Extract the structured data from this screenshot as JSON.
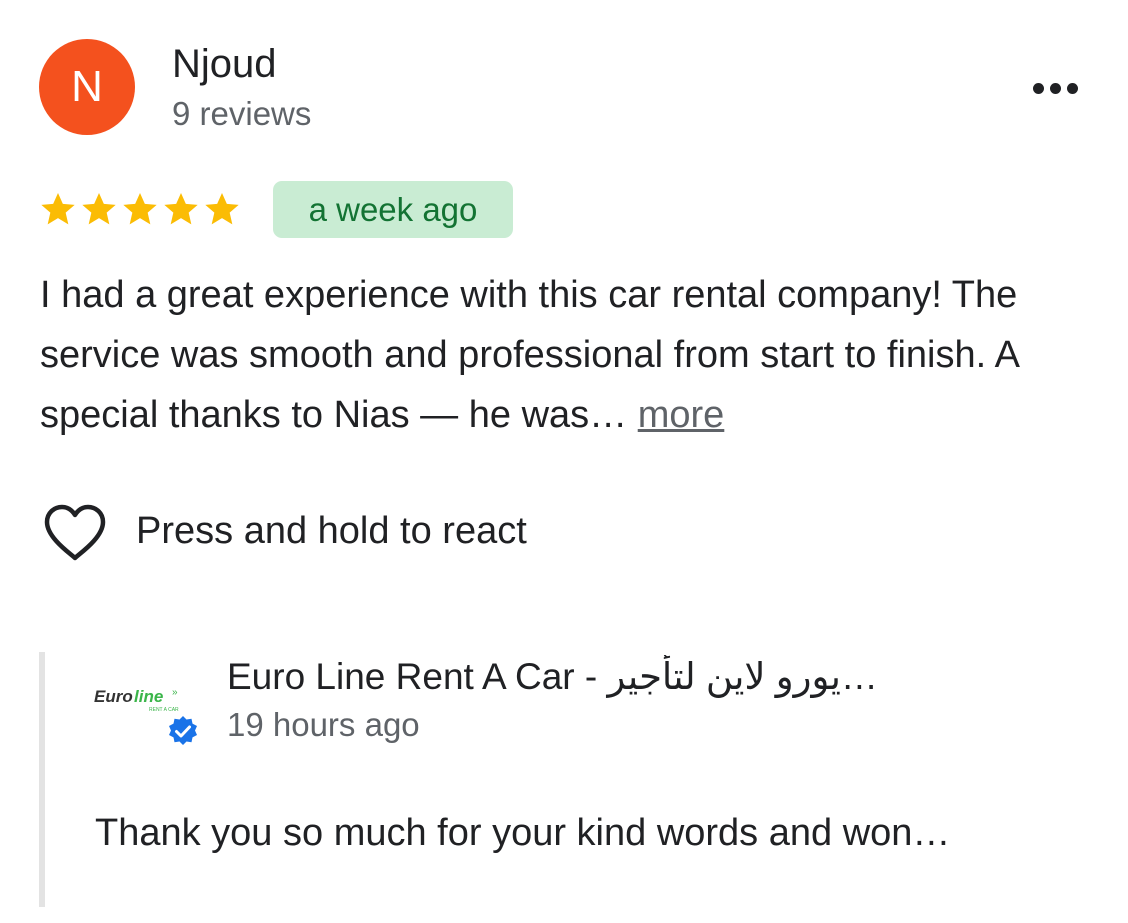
{
  "review": {
    "author": {
      "initial": "N",
      "name": "Njoud",
      "review_count": "9 reviews",
      "avatar_color": "#f4511e"
    },
    "rating": 5,
    "rating_max": 5,
    "star_color": "#fbbc04",
    "date": "a week ago",
    "text": "I had a great experience with this car rental company! The service was smooth and professional from start to finish. A special thanks to Nias — he was…",
    "more_label": "more",
    "react_label": "Press and hold to react",
    "icons": [
      "more-options-icon",
      "star-icon",
      "heart-icon"
    ]
  },
  "owner_response": {
    "logo_text": "Euroline",
    "logo_sub": "RENT A CAR",
    "name": "Euro Line Rent A Car - يورو لاين لتأجير…",
    "time": "19 hours ago",
    "text": "Thank you so much for your kind words and won…",
    "verified_icon": "verified-badge-icon",
    "accent_color": "#1a73e8"
  }
}
